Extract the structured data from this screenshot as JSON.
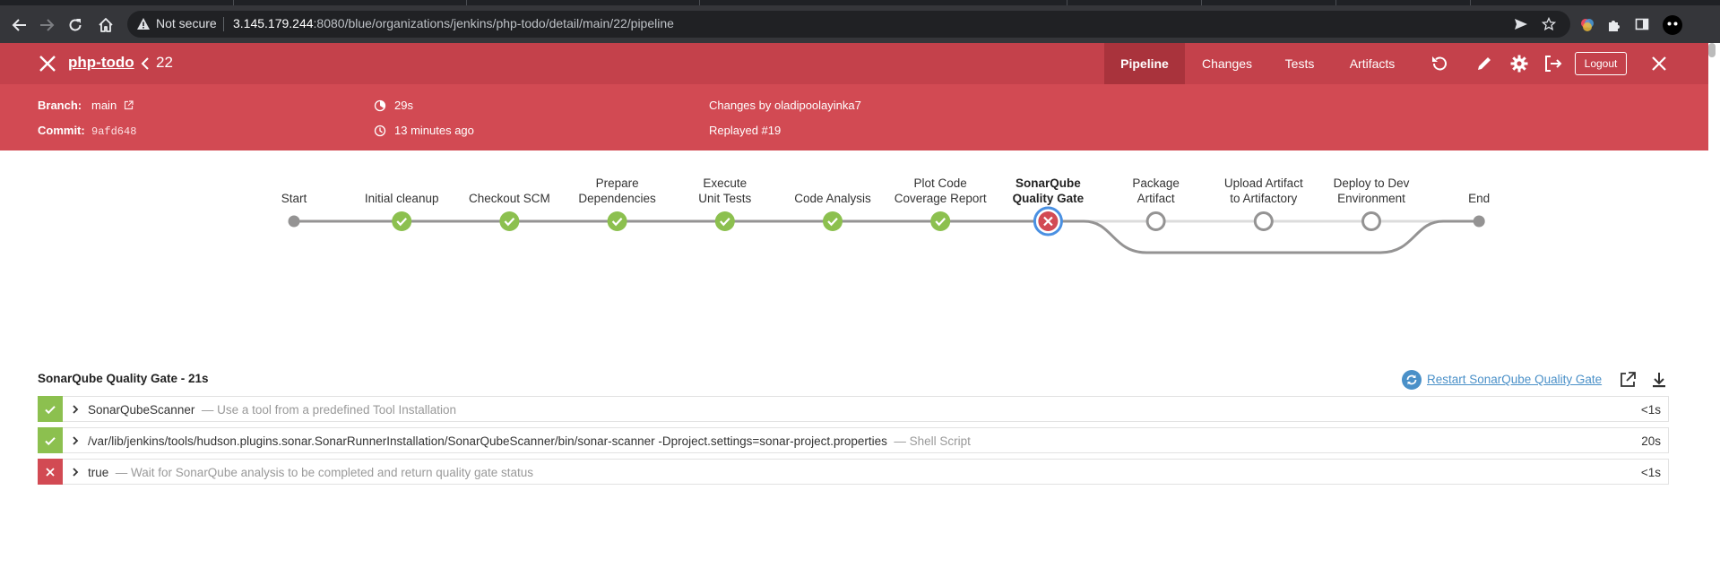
{
  "browser": {
    "security_label": "Not secure",
    "url_host": "3.145.179.244",
    "url_path": ":8080/blue/organizations/jenkins/php-todo/detail/main/22/pipeline"
  },
  "header": {
    "project": "php-todo",
    "run_number": "22",
    "tabs": [
      "Pipeline",
      "Changes",
      "Tests",
      "Artifacts"
    ],
    "logout_label": "Logout",
    "branch_label": "Branch:",
    "branch_value": "main",
    "commit_label": "Commit:",
    "commit_value": "9afd648",
    "duration": "29s",
    "time_ago": "13 minutes ago",
    "changes_by": "Changes by oladipoolayinka7",
    "replayed": "Replayed #19"
  },
  "pipeline": {
    "stages": [
      {
        "label": "Start",
        "status": "terminal"
      },
      {
        "label": "Initial cleanup",
        "status": "success"
      },
      {
        "label": "Checkout SCM",
        "status": "success"
      },
      {
        "label": "Prepare Dependencies",
        "status": "success"
      },
      {
        "label": "Execute Unit Tests",
        "status": "success"
      },
      {
        "label": "Code Analysis",
        "status": "success"
      },
      {
        "label": "Plot Code Coverage Report",
        "status": "success"
      },
      {
        "label": "SonarQube Quality Gate",
        "status": "failed",
        "selected": true
      },
      {
        "label": "Package Artifact",
        "status": "not_built"
      },
      {
        "label": "Upload Artifact to Artifactory",
        "status": "not_built"
      },
      {
        "label": "Deploy to Dev Environment",
        "status": "not_built"
      },
      {
        "label": "End",
        "status": "terminal"
      }
    ],
    "colors": {
      "success": "#8cc04f",
      "failed": "#d24a53",
      "selected_ring": "#4a90e2",
      "line": "#949393"
    }
  },
  "log": {
    "title": "SonarQube Quality Gate - 21s",
    "restart_label": "Restart SonarQube Quality Gate",
    "steps": [
      {
        "status": "success",
        "name": "SonarQubeScanner",
        "desc": "— Use a tool from a predefined Tool Installation",
        "duration": "<1s"
      },
      {
        "status": "success",
        "name": "/var/lib/jenkins/tools/hudson.plugins.sonar.SonarRunnerInstallation/SonarQubeScanner/bin/sonar-scanner -Dproject.settings=sonar-project.properties",
        "desc": "— Shell Script",
        "duration": "20s"
      },
      {
        "status": "failed",
        "name": "true",
        "desc": "— Wait for SonarQube analysis to be completed and return quality gate status",
        "duration": "<1s"
      }
    ]
  }
}
